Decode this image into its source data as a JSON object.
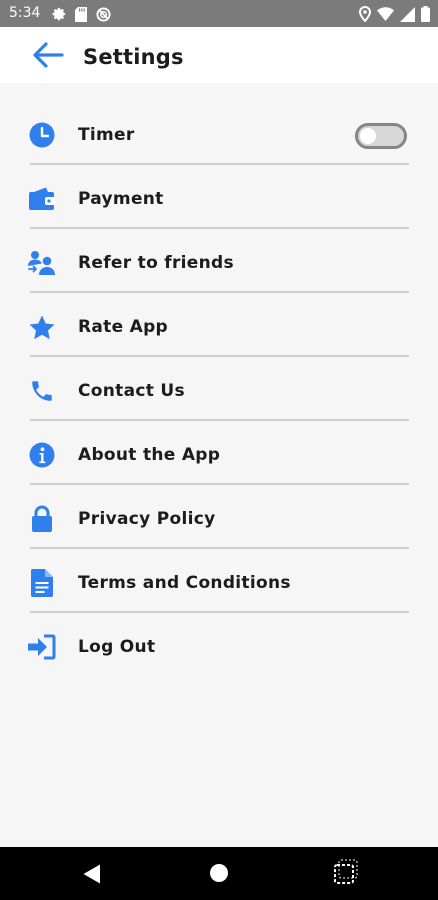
{
  "status_bar": {
    "time": "5:34",
    "left_icons": [
      "gear-icon",
      "sd-card-icon",
      "do-not-disturb-icon"
    ],
    "right_icons": [
      "location-icon",
      "wifi-icon",
      "signal-icon",
      "battery-icon"
    ]
  },
  "app_bar": {
    "back_icon": "arrow-left-icon",
    "title": "Settings"
  },
  "settings": {
    "items": [
      {
        "label": "Timer",
        "icon": "clock-icon",
        "has_toggle": true,
        "toggle_on": false
      },
      {
        "label": "Payment",
        "icon": "wallet-icon"
      },
      {
        "label": "Refer to friends",
        "icon": "refer-friends-icon"
      },
      {
        "label": "Rate App",
        "icon": "star-icon"
      },
      {
        "label": "Contact Us",
        "icon": "phone-icon"
      },
      {
        "label": "About the App",
        "icon": "info-icon"
      },
      {
        "label": "Privacy Policy",
        "icon": "lock-icon"
      },
      {
        "label": "Terms and Conditions",
        "icon": "document-icon"
      },
      {
        "label": "Log Out",
        "icon": "logout-icon"
      }
    ]
  },
  "colors": {
    "accent": "#2f80ed",
    "status_bar": "#7b7b7b",
    "background": "#f6f6f6",
    "app_bar": "#ffffff",
    "divider": "#cfcfcf",
    "nav_bar": "#000000"
  },
  "nav_bar": {
    "buttons": [
      "nav-back-icon",
      "nav-home-icon",
      "nav-recents-icon"
    ]
  }
}
